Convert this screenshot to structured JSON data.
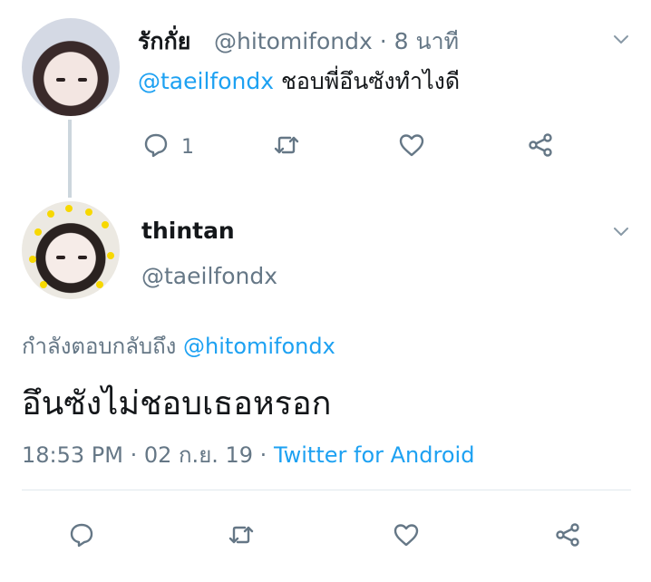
{
  "tweet_parent": {
    "display_name": "รักกั่ย",
    "handle_and_time": "@hitomifondx · 8 นาที",
    "mention": "@taeilfondx",
    "text": " ชอบพี่อึนซังทำไงดี",
    "reply_count": "1"
  },
  "tweet_main": {
    "display_name": "thintan",
    "handle": "@taeilfondx",
    "replying_to_prefix": "กำลังตอบกลับถึง ",
    "replying_to_mention": "@hitomifondx",
    "text": "อึนซังไม่ชอบเธอหรอก",
    "timestamp": "18:53 PM · 02 ก.ย. 19 · ",
    "source": "Twitter for Android"
  },
  "icons": {
    "reply": "reply-icon",
    "retweet": "retweet-icon",
    "like": "heart-icon",
    "share": "share-icon",
    "menu": "chevron-down-icon"
  },
  "colors": {
    "link": "#1da1f2",
    "secondary_text": "#657786",
    "primary_text": "#14171a",
    "icon": "#657786",
    "divider": "#e1e8ed",
    "thread_line": "#ccd6dd"
  }
}
